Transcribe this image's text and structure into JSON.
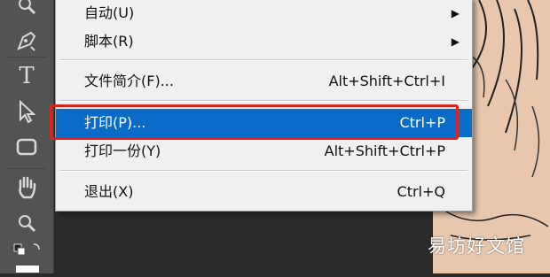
{
  "menu": {
    "items": [
      {
        "label": "自动(U)",
        "shortcut": "",
        "submenu": true
      },
      {
        "label": "脚本(R)",
        "shortcut": "",
        "submenu": true
      },
      {
        "label": "文件简介(F)...",
        "shortcut": "Alt+Shift+Ctrl+I",
        "submenu": false
      },
      {
        "label": "打印(P)...",
        "shortcut": "Ctrl+P",
        "submenu": false,
        "highlighted": true
      },
      {
        "label": "打印一份(Y)",
        "shortcut": "Alt+Shift+Ctrl+P",
        "submenu": false
      },
      {
        "label": "退出(X)",
        "shortcut": "Ctrl+Q",
        "submenu": false
      }
    ],
    "submenu_arrow": "▶"
  },
  "toolbar": {
    "tools": [
      "zoom-icon",
      "pen-tool-icon",
      "type-tool-icon",
      "path-selection-icon",
      "rectangle-tool-icon",
      "hand-tool-icon",
      "zoom-tool-icon",
      "default-colors-icon"
    ],
    "type_glyph": "T"
  },
  "watermark": "易坊好文馆",
  "colors": {
    "highlight": "#0a6cc8",
    "annotation_box": "#d8231f",
    "menu_bg": "#f0f0f0",
    "toolbar_bg": "#535353",
    "canvas": "#e9c7ac"
  }
}
